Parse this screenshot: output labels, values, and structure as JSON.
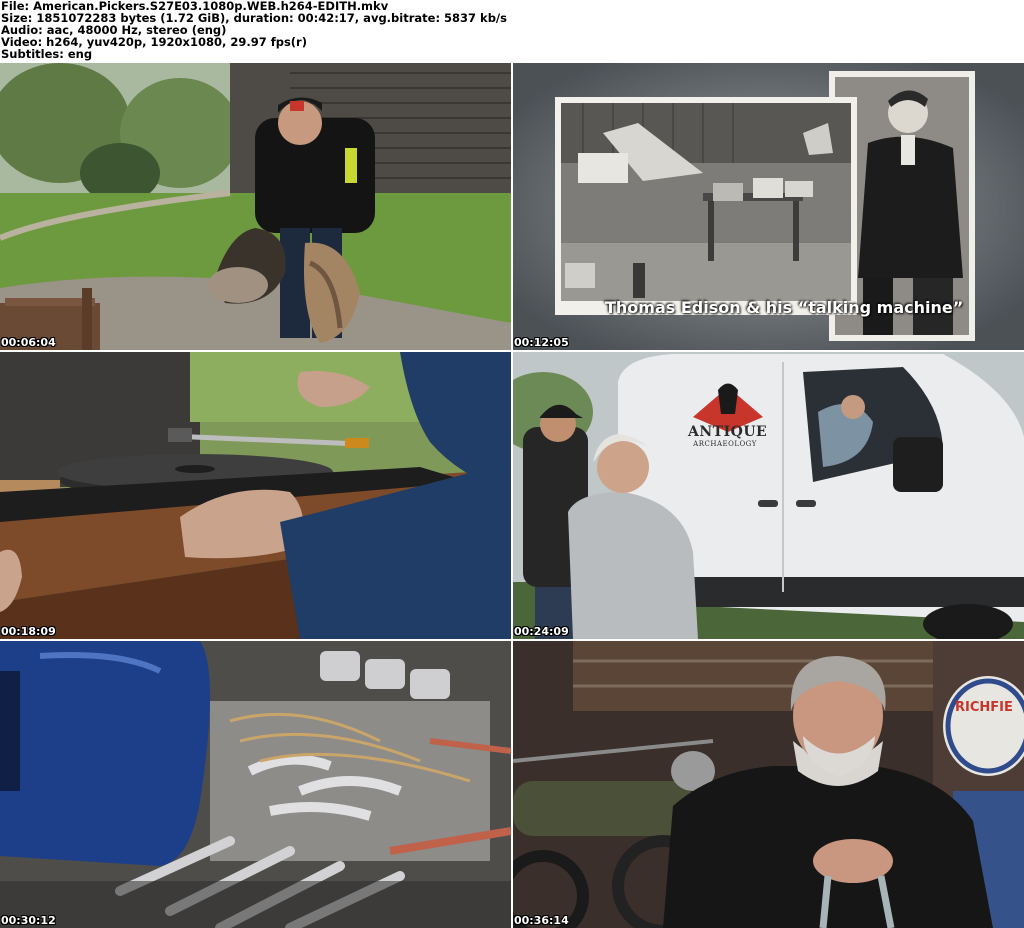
{
  "header": {
    "file_line": "File: American.Pickers.S27E03.1080p.WEB.h264-EDITH.mkv",
    "size_line": "Size: 1851072283 bytes (1.72 GiB), duration: 00:42:17, avg.bitrate: 5837 kb/s",
    "audio_line": "Audio: aac, 48000 Hz, stereo (eng)",
    "video_line": "Video: h264, yuv420p, 1920x1080, 29.97 fps(r)",
    "subs_line": "Subtitles: eng"
  },
  "thumbnails": [
    {
      "timestamp": "00:06:04",
      "scene": "man-with-saddles"
    },
    {
      "timestamp": "00:12:05",
      "scene": "edison-photographs",
      "caption": "Thomas Edison & his “talking machine”"
    },
    {
      "timestamp": "00:18:09",
      "scene": "record-player"
    },
    {
      "timestamp": "00:24:09",
      "scene": "van-conversation",
      "van_brand": "ANTIQUE",
      "van_sub": "ARCHAEOLOGY"
    },
    {
      "timestamp": "00:30:12",
      "scene": "engine-model"
    },
    {
      "timestamp": "00:36:14",
      "scene": "interview",
      "sign": "RICHFIE"
    }
  ],
  "colors": {
    "background": "#ffffff",
    "text": "#000000",
    "timestamp": "#ffffff"
  }
}
